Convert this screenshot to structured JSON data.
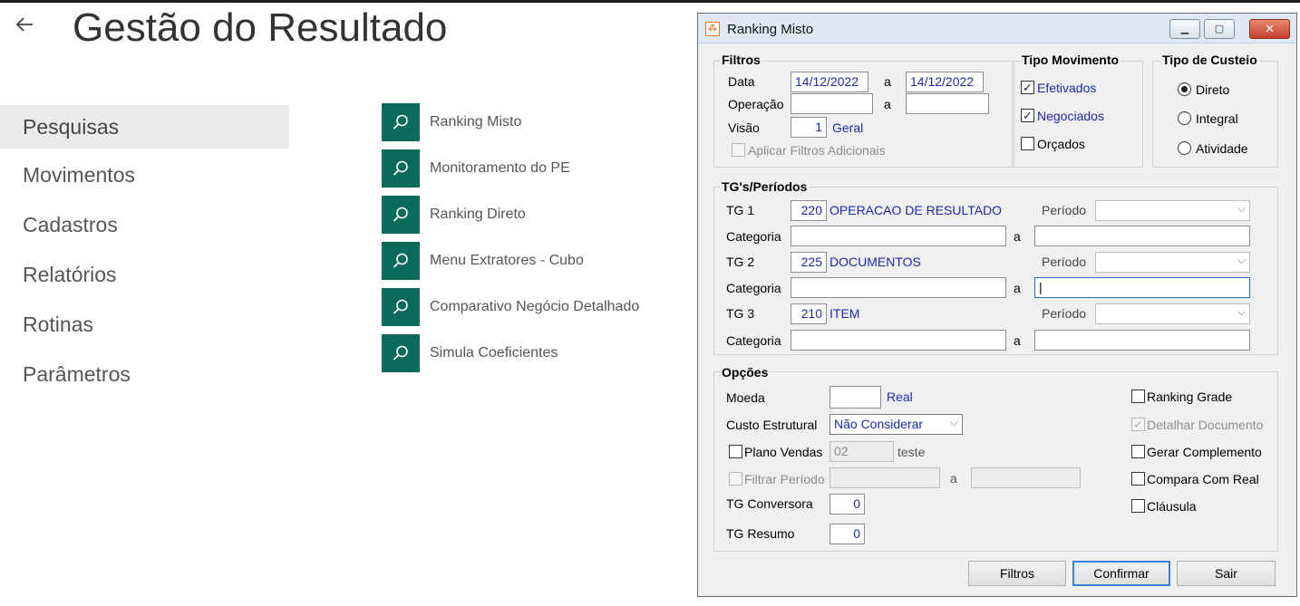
{
  "app": {
    "title": "Gestão do Resultado",
    "nav": [
      "Pesquisas",
      "Movimentos",
      "Cadastros",
      "Relatórios",
      "Rotinas",
      "Parâmetros"
    ],
    "searches": [
      "Ranking Misto",
      "Monitoramento do PE",
      "Ranking Direto",
      "Menu Extratores - Cubo",
      "Comparativo Negócio Detalhado",
      "Simula Coeficientes"
    ]
  },
  "dialog": {
    "title": "Ranking Misto",
    "filtros": {
      "legend": "Filtros",
      "data_label": "Data",
      "data_from": "14/12/2022",
      "a": "a",
      "data_to": "14/12/2022",
      "operacao_label": "Operação",
      "visao_label": "Visão",
      "visao_value": "1",
      "visao_desc": "Geral",
      "aplicar_label": "Aplicar Filtros Adicionais"
    },
    "tipo_movimento": {
      "legend": "Tipo Movimento",
      "efetivados": "Efetivados",
      "negociados": "Negociados",
      "orcados": "Orçados"
    },
    "tipo_custeio": {
      "legend": "Tipo de Custeio",
      "direto": "Direto",
      "integral": "Integral",
      "atividade": "Atividade"
    },
    "tgs": {
      "legend": "TG's/Períodos",
      "categoria_label": "Categoria",
      "periodo_label": "Período",
      "a": "a",
      "rows": [
        {
          "label": "TG 1",
          "code": "220",
          "desc": "OPERACAO DE RESULTADO"
        },
        {
          "label": "TG 2",
          "code": "225",
          "desc": "DOCUMENTOS"
        },
        {
          "label": "TG 3",
          "code": "210",
          "desc": "ITEM"
        }
      ]
    },
    "opcoes": {
      "legend": "Opções",
      "moeda_label": "Moeda",
      "moeda_desc": "Real",
      "custo_label": "Custo Estrutural",
      "custo_value": "Não Considerar",
      "plano_label": "Plano Vendas",
      "plano_value": "02",
      "plano_desc": "teste",
      "filtrar_label": "Filtrar Período",
      "a": "a",
      "tg_conv_label": "TG Conversora",
      "tg_conv_value": "0",
      "tg_res_label": "TG Resumo",
      "tg_res_value": "0",
      "ranking_grade": "Ranking Grade",
      "detalhar": "Detalhar Documento",
      "gerar": "Gerar Complemento",
      "compara": "Compara Com Real",
      "clausula": "Cláusula"
    },
    "buttons": {
      "filtros": "Filtros",
      "confirmar": "Confirmar",
      "sair": "Sair"
    }
  },
  "colors": {
    "tile": "#0a6b5d",
    "accent_text": "#1a2aa8"
  }
}
